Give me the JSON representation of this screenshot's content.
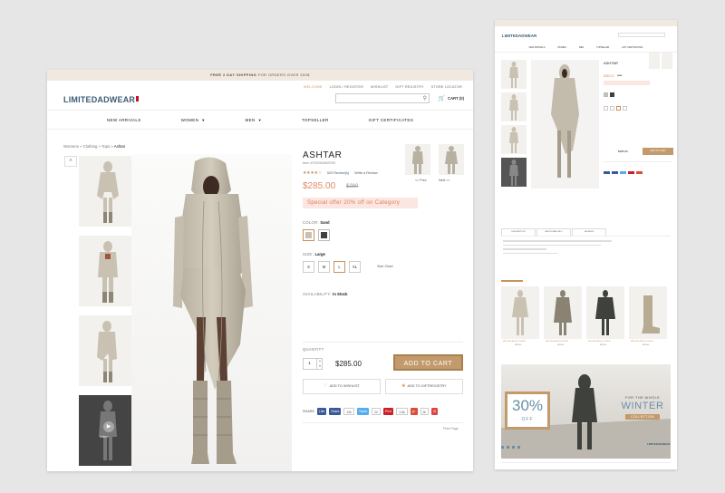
{
  "main": {
    "shipping_banner": {
      "bold": "FREE 2 DAY SHIPPING",
      "rest": " FOR ORDERS OVER 300$"
    },
    "top_links": [
      "WELCOME",
      "LOGIN / REGISTER",
      "WISHLIST",
      "GIFT REGISTRY",
      "STORE LOCATOR"
    ],
    "logo": "LIMITEDADWEAR",
    "cart_label": "CART (0)",
    "nav": [
      {
        "label": "NEW ARRIVALS",
        "has_menu": false
      },
      {
        "label": "WOMEN",
        "has_menu": true
      },
      {
        "label": "MEN",
        "has_menu": true
      },
      {
        "label": "TOPSELLER",
        "has_menu": false
      },
      {
        "label": "GIFT CERTIFICATES",
        "has_menu": false
      }
    ],
    "breadcrumb": {
      "path": "Womens » Clothing » Tops » ",
      "current": "Ashtar"
    },
    "video_label": "video",
    "product": {
      "title": "ASHTAR",
      "item_no": "Item #700252865769",
      "reviews": "523 Review(s)",
      "write_review": "Write a Review",
      "stars": "★★★★☆",
      "price": "$285.00",
      "old_price": "$280",
      "offer": "Special offer 20% off on Category",
      "color_label": "COLOR:",
      "color_value": "Sand",
      "swatch_colors": [
        "#c9c2b3",
        "#3f423c"
      ],
      "size_label": "SIZE:",
      "size_value": "Large",
      "sizes": [
        "S",
        "M",
        "L",
        "XL"
      ],
      "size_chart": "Size Chart",
      "availability_label": "AVAILABILITY:",
      "availability_value": "In Stock",
      "quantity_label": "QUANTITY",
      "quantity": "1",
      "qty_price": "$285.00",
      "add_to_cart": "ADD TO CART",
      "add_to_wishlist": "ADD TO WISHLIST",
      "add_to_registry": "ADD TO GIFTREGISTRY",
      "share_label": "SHARE",
      "share_buttons": [
        {
          "label": "Like",
          "color": "#3b5998",
          "count": ""
        },
        {
          "label": "Share",
          "color": "#3b5998",
          "count": "12k"
        },
        {
          "label": "Tweet",
          "color": "#55acee",
          "count": "24"
        },
        {
          "label": "Pin it",
          "color": "#cb2027",
          "count": "1.5k"
        },
        {
          "label": "g+",
          "color": "#dd4b39",
          "count": "2k"
        }
      ],
      "print": "Print Page",
      "prev_label": "<< Prev",
      "next_label": "Next >>"
    }
  },
  "preview": {
    "logo": "LIMITEDADWEAR",
    "nav": [
      "NEW ARRIVALS",
      "WOMEN",
      "MEN",
      "TOPSELLER",
      "GIFT CERTIFICATES"
    ],
    "title": "ASHTAR",
    "price": "$285.00",
    "old_price": "$280",
    "qty_price": "$285.00",
    "add_to_cart": "ADD TO CART",
    "tabs": [
      "DESCRIPTION",
      "ADDITIONAL INFO",
      "REVIEWS"
    ],
    "products": [
      {
        "name": "MEDIUM FASHION DRESS",
        "price": "$285.00"
      },
      {
        "name": "MEDIUM FASHION DRESS",
        "price": "$285.00"
      },
      {
        "name": "MEDIUM FASHION DRESS",
        "price": "$285.00"
      },
      {
        "name": "MEDIUM FASHION DRESS",
        "price": "$285.00"
      }
    ],
    "banner": {
      "discount": "30%",
      "off": "OFF",
      "line1": "FOR THE WHOLE",
      "line2": "WINTER",
      "line3": "COLLECTION"
    }
  }
}
